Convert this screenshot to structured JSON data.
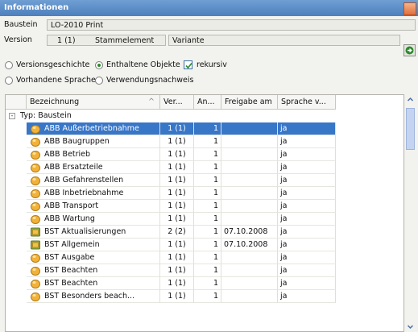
{
  "window": {
    "title": "Informationen"
  },
  "form": {
    "baustein_label": "Baustein",
    "baustein_value": "LO-2010 Print",
    "version_label": "Version",
    "version_value": "1 (1)",
    "stammelement_value": "Stammelement",
    "variante_value": "Variante"
  },
  "options": {
    "versionsgeschichte": "Versionsgeschichte",
    "enthaltene_objekte": "Enthaltene Objekte",
    "rekursiv": "rekursiv",
    "vorhandene_sprachen": "Vorhandene Sprachen",
    "verwendungsnachweis": "Verwendungsnachweis",
    "selected": "enthaltene_objekte",
    "rekursiv_checked": true
  },
  "table": {
    "columns": [
      "Bezeichnung",
      "Ver...",
      "An...",
      "Freigabe am",
      "Sprache v..."
    ],
    "group_label": "Typ: Baustein",
    "rows": [
      {
        "icon": "object-icon",
        "name": "ABB Außerbetriebnahme",
        "ver": "1 (1)",
        "an": "1",
        "freigabe": "",
        "sprache": "ja",
        "selected": true
      },
      {
        "icon": "object-icon",
        "name": "ABB Baugruppen",
        "ver": "1 (1)",
        "an": "1",
        "freigabe": "",
        "sprache": "ja"
      },
      {
        "icon": "object-icon",
        "name": "ABB Betrieb",
        "ver": "1 (1)",
        "an": "1",
        "freigabe": "",
        "sprache": "ja"
      },
      {
        "icon": "object-icon",
        "name": "ABB Ersatzteile",
        "ver": "1 (1)",
        "an": "1",
        "freigabe": "",
        "sprache": "ja"
      },
      {
        "icon": "object-icon",
        "name": "ABB Gefahrenstellen",
        "ver": "1 (1)",
        "an": "1",
        "freigabe": "",
        "sprache": "ja"
      },
      {
        "icon": "object-icon",
        "name": "ABB Inbetriebnahme",
        "ver": "1 (1)",
        "an": "1",
        "freigabe": "",
        "sprache": "ja"
      },
      {
        "icon": "object-icon",
        "name": "ABB Transport",
        "ver": "1 (1)",
        "an": "1",
        "freigabe": "",
        "sprache": "ja"
      },
      {
        "icon": "object-icon",
        "name": "ABB Wartung",
        "ver": "1 (1)",
        "an": "1",
        "freigabe": "",
        "sprache": "ja"
      },
      {
        "icon": "released-object-icon",
        "name": "BST Aktualisierungen",
        "ver": "2 (2)",
        "an": "1",
        "freigabe": "07.10.2008",
        "sprache": "ja"
      },
      {
        "icon": "released-object-icon",
        "name": "BST Allgemein",
        "ver": "1 (1)",
        "an": "1",
        "freigabe": "07.10.2008",
        "sprache": "ja"
      },
      {
        "icon": "object-icon",
        "name": "BST Ausgabe",
        "ver": "1 (1)",
        "an": "1",
        "freigabe": "",
        "sprache": "ja"
      },
      {
        "icon": "object-icon",
        "name": "BST Beachten",
        "ver": "1 (1)",
        "an": "1",
        "freigabe": "",
        "sprache": "ja"
      },
      {
        "icon": "object-icon",
        "name": "BST Beachten",
        "ver": "1 (1)",
        "an": "1",
        "freigabe": "",
        "sprache": "ja"
      },
      {
        "icon": "object-icon",
        "name": "BST Besonders beach...",
        "ver": "1 (1)",
        "an": "1",
        "freigabe": "",
        "sprache": "ja"
      }
    ]
  },
  "colors": {
    "selection": "#3876c8",
    "title_bar": "#5a8bc8",
    "go_button_arrow": "#2d8a2d"
  }
}
